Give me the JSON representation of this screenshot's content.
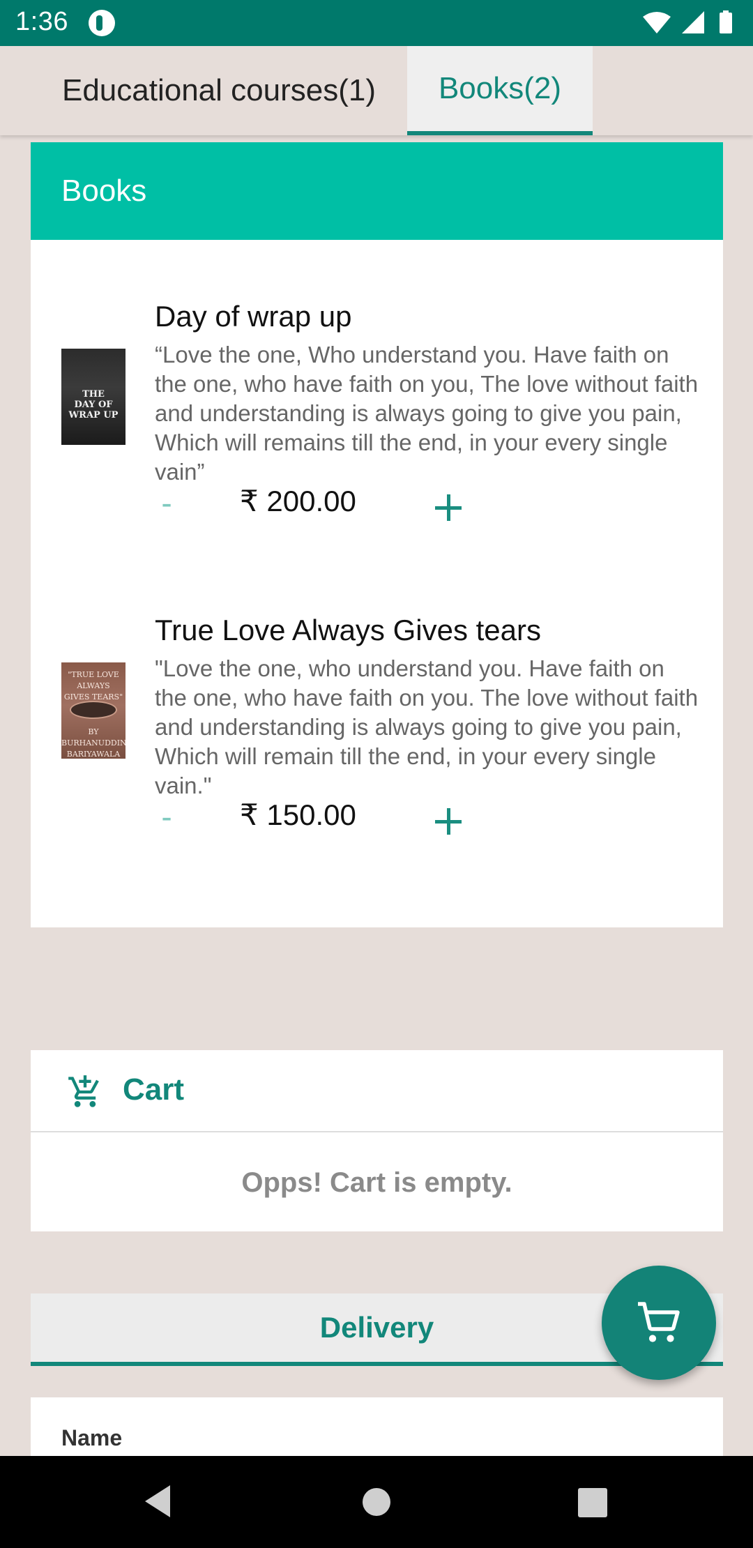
{
  "status_bar": {
    "time": "1:36"
  },
  "tabs": [
    {
      "label": "Educational courses(1)",
      "selected": false
    },
    {
      "label": "Books(2)",
      "selected": true
    }
  ],
  "books_section": {
    "header": "Books",
    "items": [
      {
        "title": "Day of wrap up",
        "description": "“Love the one, Who understand you. Have faith on the one, who have faith on you, The love without faith and understanding is always going to give you pain, Which will remains till the end, in your every single vain”",
        "price": "₹ 200.00",
        "minus": "-",
        "cover_text": "THE DAY OF WRAP UP"
      },
      {
        "title": "True Love Always Gives tears",
        "description": "\"Love the one, who understand you. Have faith on the one, who have faith on you. The love without faith and understanding is always going to give you pain, Which will remain till the end, in your every single vain.\"",
        "price": "₹ 150.00",
        "minus": "-",
        "cover_text": "\"TRUE LOVE ALWAYS GIVES TEARS\" BY BURHANUDDIN BARIYAWALA"
      }
    ]
  },
  "cart": {
    "label": "Cart",
    "empty_message": "Opps! Cart is empty."
  },
  "delivery": {
    "tab_label": "Delivery",
    "name_label": "Name"
  },
  "colors": {
    "primary": "#00796b",
    "accent": "#00bfa5",
    "teal_text": "#12877a",
    "background": "#e6ddd9"
  },
  "icons": {
    "cart_header": "add-shopping-cart-icon",
    "fab": "shopping-cart-icon",
    "nav_back": "back-triangle-icon",
    "nav_home": "home-circle-icon",
    "nav_recent": "recents-square-icon"
  }
}
